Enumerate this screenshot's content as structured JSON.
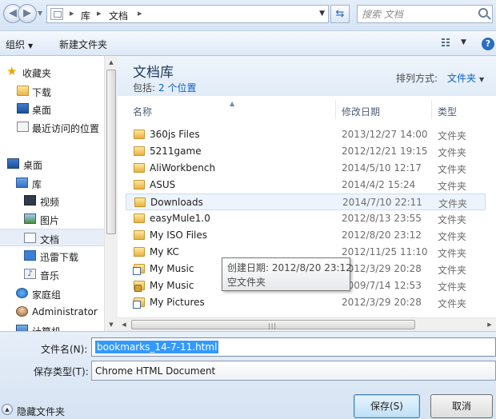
{
  "address": {
    "crumbs": [
      "库",
      "文档"
    ],
    "search_placeholder": "搜索 文档"
  },
  "toolbar": {
    "organize": "组织",
    "new_folder": "新建文件夹"
  },
  "nav": {
    "items": [
      {
        "label": "收藏夹",
        "icon": "star-icon"
      },
      {
        "label": "下载",
        "icon": "download-folder-icon"
      },
      {
        "label": "桌面",
        "icon": "desktop-icon"
      },
      {
        "label": "最近访问的位置",
        "icon": "recent-places-icon"
      },
      {
        "label": "桌面",
        "icon": "desktop-icon"
      },
      {
        "label": "库",
        "icon": "library-icon"
      },
      {
        "label": "视频",
        "icon": "video-library-icon"
      },
      {
        "label": "图片",
        "icon": "pictures-library-icon"
      },
      {
        "label": "文档",
        "icon": "documents-library-icon"
      },
      {
        "label": "迅雷下载",
        "icon": "xunlei-download-icon"
      },
      {
        "label": "音乐",
        "icon": "music-library-icon"
      },
      {
        "label": "家庭组",
        "icon": "homegroup-icon"
      },
      {
        "label": "Administrator",
        "icon": "user-folder-icon"
      },
      {
        "label": "计算机",
        "icon": "computer-icon"
      }
    ]
  },
  "library": {
    "title": "文档库",
    "includes_label": "包括:",
    "includes_link": "2 个位置",
    "arrange_label": "排列方式:",
    "arrange_value": "文件夹"
  },
  "columns": {
    "name": "名称",
    "date": "修改日期",
    "type": "类型"
  },
  "files": [
    {
      "name": "360js Files",
      "date": "2013/12/27 14:00",
      "type": "文件夹"
    },
    {
      "name": "5211game",
      "date": "2012/12/21 19:15",
      "type": "文件夹"
    },
    {
      "name": "AliWorkbench",
      "date": "2014/5/10 12:17",
      "type": "文件夹"
    },
    {
      "name": "ASUS",
      "date": "2014/4/2 15:24",
      "type": "文件夹"
    },
    {
      "name": "Downloads",
      "date": "2014/7/10 22:11",
      "type": "文件夹"
    },
    {
      "name": "easyMule1.0",
      "date": "2012/8/13 23:55",
      "type": "文件夹"
    },
    {
      "name": "My ISO Files",
      "date": "2012/8/20 23:12",
      "type": "文件夹"
    },
    {
      "name": "My KC",
      "date": "2012/11/25 11:10",
      "type": "文件夹"
    },
    {
      "name": "My Music",
      "date": "2012/3/29 20:28",
      "type": "文件夹"
    },
    {
      "name": "My Music",
      "date": "2009/7/14 12:53",
      "type": "文件夹"
    },
    {
      "name": "My Pictures",
      "date": "2012/3/29 20:28",
      "type": "文件夹"
    }
  ],
  "tooltip": {
    "created": "创建日期: 2012/8/20 23:12",
    "status": "空文件夹"
  },
  "form": {
    "filename_label": "文件名(N):",
    "filename_value": "bookmarks_14-7-11.html",
    "filetype_label": "保存类型(T):",
    "filetype_value": "Chrome HTML Document",
    "hide_folders": "隐藏文件夹",
    "save": "保存(S)",
    "cancel": "取消"
  }
}
